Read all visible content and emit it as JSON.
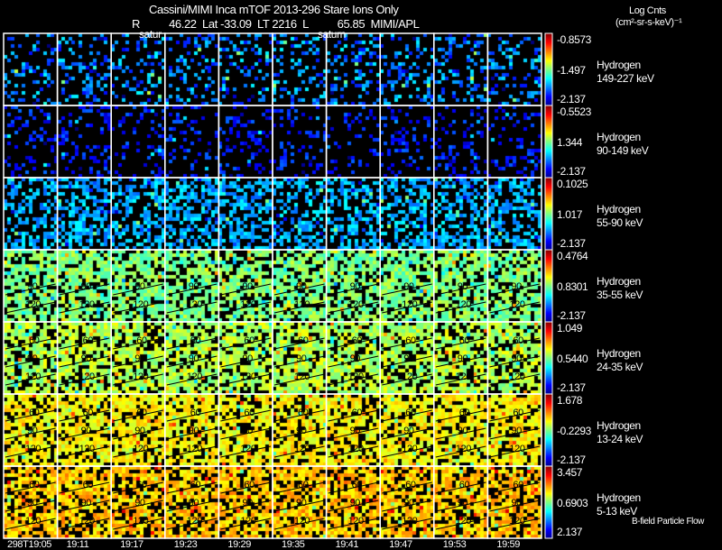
{
  "header": {
    "title": "Cassini/MIMI Inca mTOF  2013-296   Stare   Ions Only",
    "ephemeris": "R          46.22  Lat -33.09  LT 2216  L          65.85  MIMI/APL",
    "overlay_left": "satur",
    "overlay_right": "saturn",
    "units_line1": "Log Cnts",
    "units_line2": "(cm²-sr-s-keV)⁻¹"
  },
  "footer": {
    "legend": "B-field Particle Flow"
  },
  "chart_data": {
    "type": "heatmap",
    "layout": "grid of 7 energy-channel rows x 10 time columns",
    "colormap": "jet",
    "time_ticks": [
      "298T19:05",
      "19:11",
      "19:17",
      "19:23",
      "19:29",
      "19:35",
      "19:41",
      "19:47",
      "19:53",
      "19:59"
    ],
    "contour_labels": [
      "60",
      "90",
      "120"
    ],
    "rows": [
      {
        "species": "Hydrogen",
        "energy": "149-227 keV",
        "cmax": "-0.8573",
        "cmid": "-1.497",
        "cmin": "-2.137",
        "contours": false
      },
      {
        "species": "Hydrogen",
        "energy": "90-149 keV",
        "cmax": "-0.5523",
        "cmid": "1.344",
        "cmin": "-2.137",
        "contours": false
      },
      {
        "species": "Hydrogen",
        "energy": "55-90 keV",
        "cmax": "0.1025",
        "cmid": "1.017",
        "cmin": "-2.137",
        "contours": false
      },
      {
        "species": "Hydrogen",
        "energy": "35-55 keV",
        "cmax": "0.4764",
        "cmid": "0.8301",
        "cmin": "-2.137",
        "contours": true
      },
      {
        "species": "Hydrogen",
        "energy": "24-35 keV",
        "cmax": "1.049",
        "cmid": "0.5440",
        "cmin": "-2.137",
        "contours": true
      },
      {
        "species": "Hydrogen",
        "energy": "13-24 keV",
        "cmax": "1.678",
        "cmid": "-0.2293",
        "cmin": "-2.137",
        "contours": true
      },
      {
        "species": "Hydrogen",
        "energy": "5-13 keV",
        "cmax": "3.457",
        "cmid": "0.6903",
        "cmin": "2.137",
        "contours": true
      }
    ]
  }
}
